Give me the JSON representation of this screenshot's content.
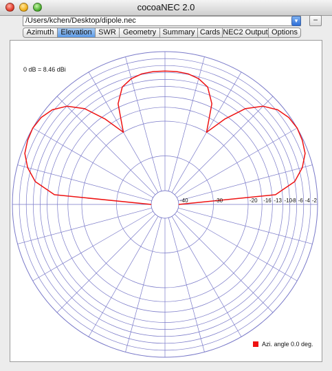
{
  "window": {
    "title": "cocoaNEC 2.0"
  },
  "file": {
    "path": "/Users/kchen/Desktop/dipole.nec",
    "minus_label": "−",
    "dropdown_glyph": "▾"
  },
  "tabs": [
    {
      "label": "Azimuth",
      "active": false
    },
    {
      "label": "Elevation",
      "active": true
    },
    {
      "label": "SWR",
      "active": false
    },
    {
      "label": "Geometry",
      "active": false
    },
    {
      "label": "Summary",
      "active": false
    },
    {
      "label": "Cards",
      "active": false
    },
    {
      "label": "NEC2 Output",
      "active": false
    },
    {
      "label": "Options",
      "active": false
    }
  ],
  "plot": {
    "reference_text": "0 dB = 8.46 dBi",
    "db_ticks": [
      "-40",
      "-30",
      "-20",
      "-16",
      "-13",
      "-10",
      "-8",
      "-6",
      "-4",
      "-2"
    ],
    "legend_label": "Azi. angle  0.0 deg.",
    "trace_color": "#ee1111",
    "grid_color": "#7878c8"
  },
  "chart_data": {
    "type": "polar",
    "series": [
      {
        "name": "Azi. angle  0.0 deg.",
        "elevation_deg": [
          0,
          5,
          10,
          15,
          20,
          25,
          30,
          35,
          40,
          45,
          50,
          55,
          60,
          65,
          70,
          75,
          80,
          85,
          90,
          95,
          100,
          105,
          110,
          115,
          120,
          125,
          130,
          135,
          140,
          145,
          150,
          155,
          160,
          165,
          170,
          175,
          180
        ],
        "gain_db": [
          -40,
          -12,
          -6,
          -3,
          -1,
          -0.3,
          0,
          -0.4,
          -1.6,
          -4,
          -8,
          -14,
          -20,
          -12,
          -8,
          -6.5,
          -5.8,
          -5.6,
          -5.6,
          -5.6,
          -5.8,
          -6.5,
          -8,
          -12,
          -20,
          -14,
          -8,
          -4,
          -1.6,
          -0.4,
          0,
          -0.3,
          -1,
          -3,
          -6,
          -12,
          -40
        ]
      }
    ],
    "r_ticks_db": [
      -40,
      -30,
      -20,
      -16,
      -13,
      -10,
      -8,
      -6,
      -4,
      -2
    ],
    "grid": true,
    "legend": "bottom-right"
  }
}
